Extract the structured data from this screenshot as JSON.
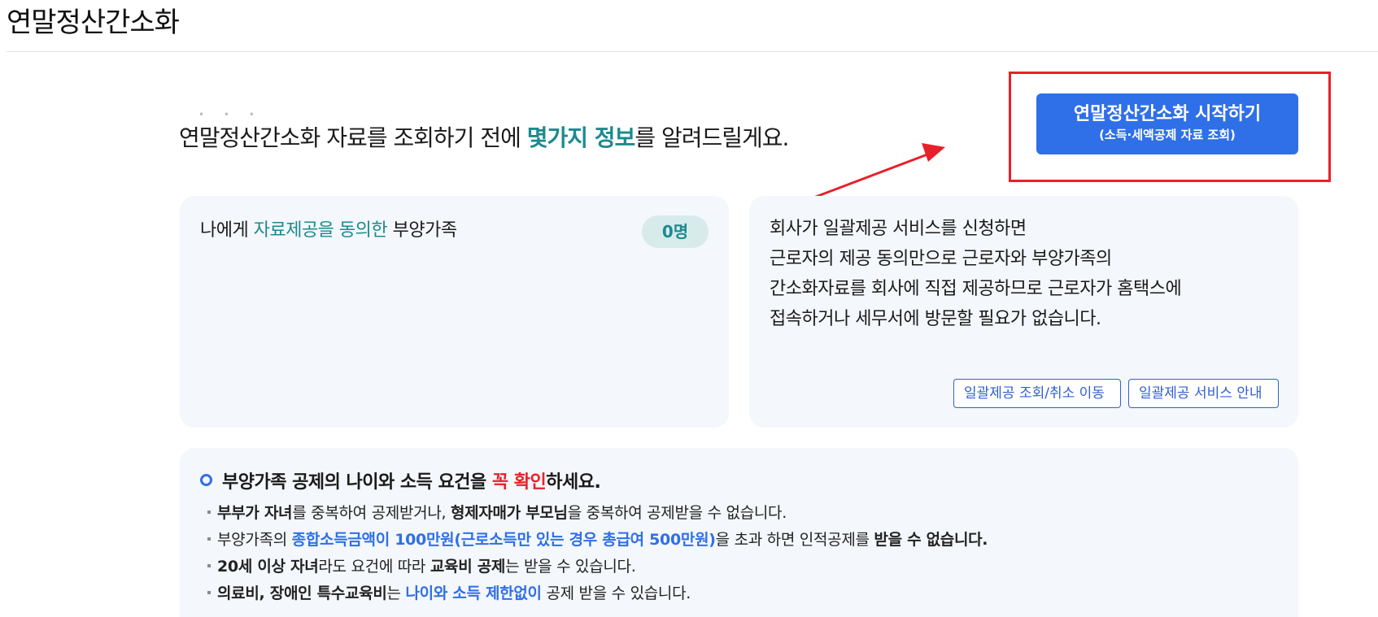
{
  "page": {
    "title": "연말정산간소화"
  },
  "intro": {
    "dots": "• • •",
    "prefix": "연말정산간소화 자료를 조회하기 전에 ",
    "highlight": "몇가지 정보",
    "suffix": "를 알려드릴게요."
  },
  "start_button": {
    "label": "연말정산간소화 시작하기",
    "sublabel": "(소득·세액공제 자료 조회)"
  },
  "consent_card": {
    "label_prefix": "나에게 ",
    "label_highlight": "자료제공을 동의한",
    "label_suffix": " 부양가족",
    "count": "0명"
  },
  "bulk_card": {
    "lines": [
      "회사가 일괄제공 서비스를 신청하면",
      "근로자의 제공 동의만으로 근로자와 부양가족의",
      "간소화자료를 회사에 직접 제공하므로 근로자가 홈택스에",
      "접속하거나 세무서에 방문할 필요가 없습니다."
    ],
    "query_button": "일괄제공 조회/취소 이동",
    "guide_button": "일괄제공 서비스 안내"
  },
  "notice": {
    "heading_prefix": "부양가족 공제의 나이와 소득 요건을 ",
    "heading_highlight": "꼭 확인",
    "heading_suffix": "하세요.",
    "bullet1": {
      "b1": "부부가 자녀",
      "t1": "를 중복하여 공제받거나, ",
      "b2": "형제자매가 부모님",
      "t2": "을 중복하여 공제받을 수 없습니다."
    },
    "bullet2": {
      "t1": "부양가족의 ",
      "blue": "종합소득금액이 100만원(근로소득만 있는 경우 총급여 500만원)",
      "t2": "을 초과 하면 인적공제를 ",
      "b1": "받을 수 없습니다."
    },
    "bullet3": {
      "b1": "20세 이상 자녀",
      "t1": "라도 요건에 따라 ",
      "b2": "교육비 공제",
      "t2": "는 받을 수 있습니다."
    },
    "bullet4": {
      "b1": "의료비, 장애인 특수교육비",
      "t1": "는 ",
      "blue": "나이와 소득 제한없이",
      "t2": " 공제 받을 수 있습니다."
    }
  },
  "colors": {
    "accent_blue": "#2f6fe8",
    "teal": "#1b8a8f",
    "highlight_red": "#e8202a",
    "card_background": "#f4f7fb"
  }
}
